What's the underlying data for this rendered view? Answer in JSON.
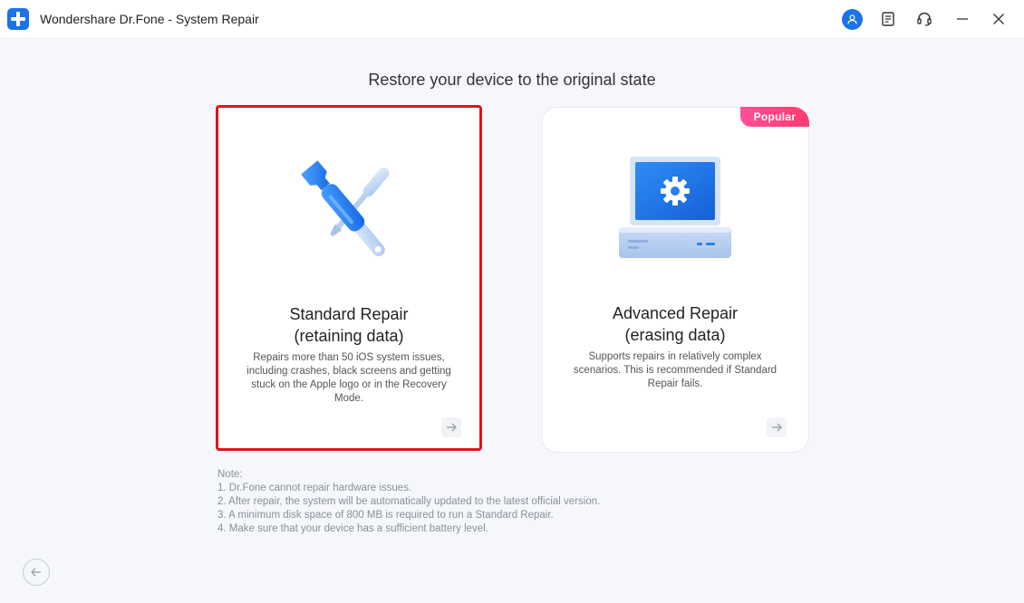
{
  "window": {
    "title": "Wondershare Dr.Fone - System Repair"
  },
  "titlebar_icons": [
    "user-account-icon",
    "notes-icon",
    "headset-support-icon",
    "minimize-icon",
    "close-icon"
  ],
  "heading": "Restore your device to the original state",
  "cards": {
    "standard": {
      "title_line1": "Standard Repair",
      "title_line2": "(retaining data)",
      "description": "Repairs more than 50 iOS system issues, including crashes, black screens and getting stuck on the Apple logo or in the Recovery Mode.",
      "selected": true,
      "icon": "wrench-screwdriver-icon"
    },
    "advanced": {
      "title_line1": "Advanced Repair",
      "title_line2": "(erasing data)",
      "description": "Supports repairs in relatively complex scenarios. This is recommended if Standard Repair fails.",
      "badge": "Popular",
      "icon": "computer-gear-icon"
    }
  },
  "notes": {
    "label": "Note:",
    "items": [
      "1. Dr.Fone cannot repair hardware issues.",
      "2. After repair, the system will be automatically updated to the latest official version.",
      "3. A minimum disk space of 800 MB is required to run a Standard Repair.",
      "4. Make sure that your device has a sufficient battery level."
    ]
  },
  "colors": {
    "accent": "#1a73e8",
    "selected_border": "#e0121c",
    "badge": "#ff4f9a",
    "background": "#f5f7fb"
  }
}
